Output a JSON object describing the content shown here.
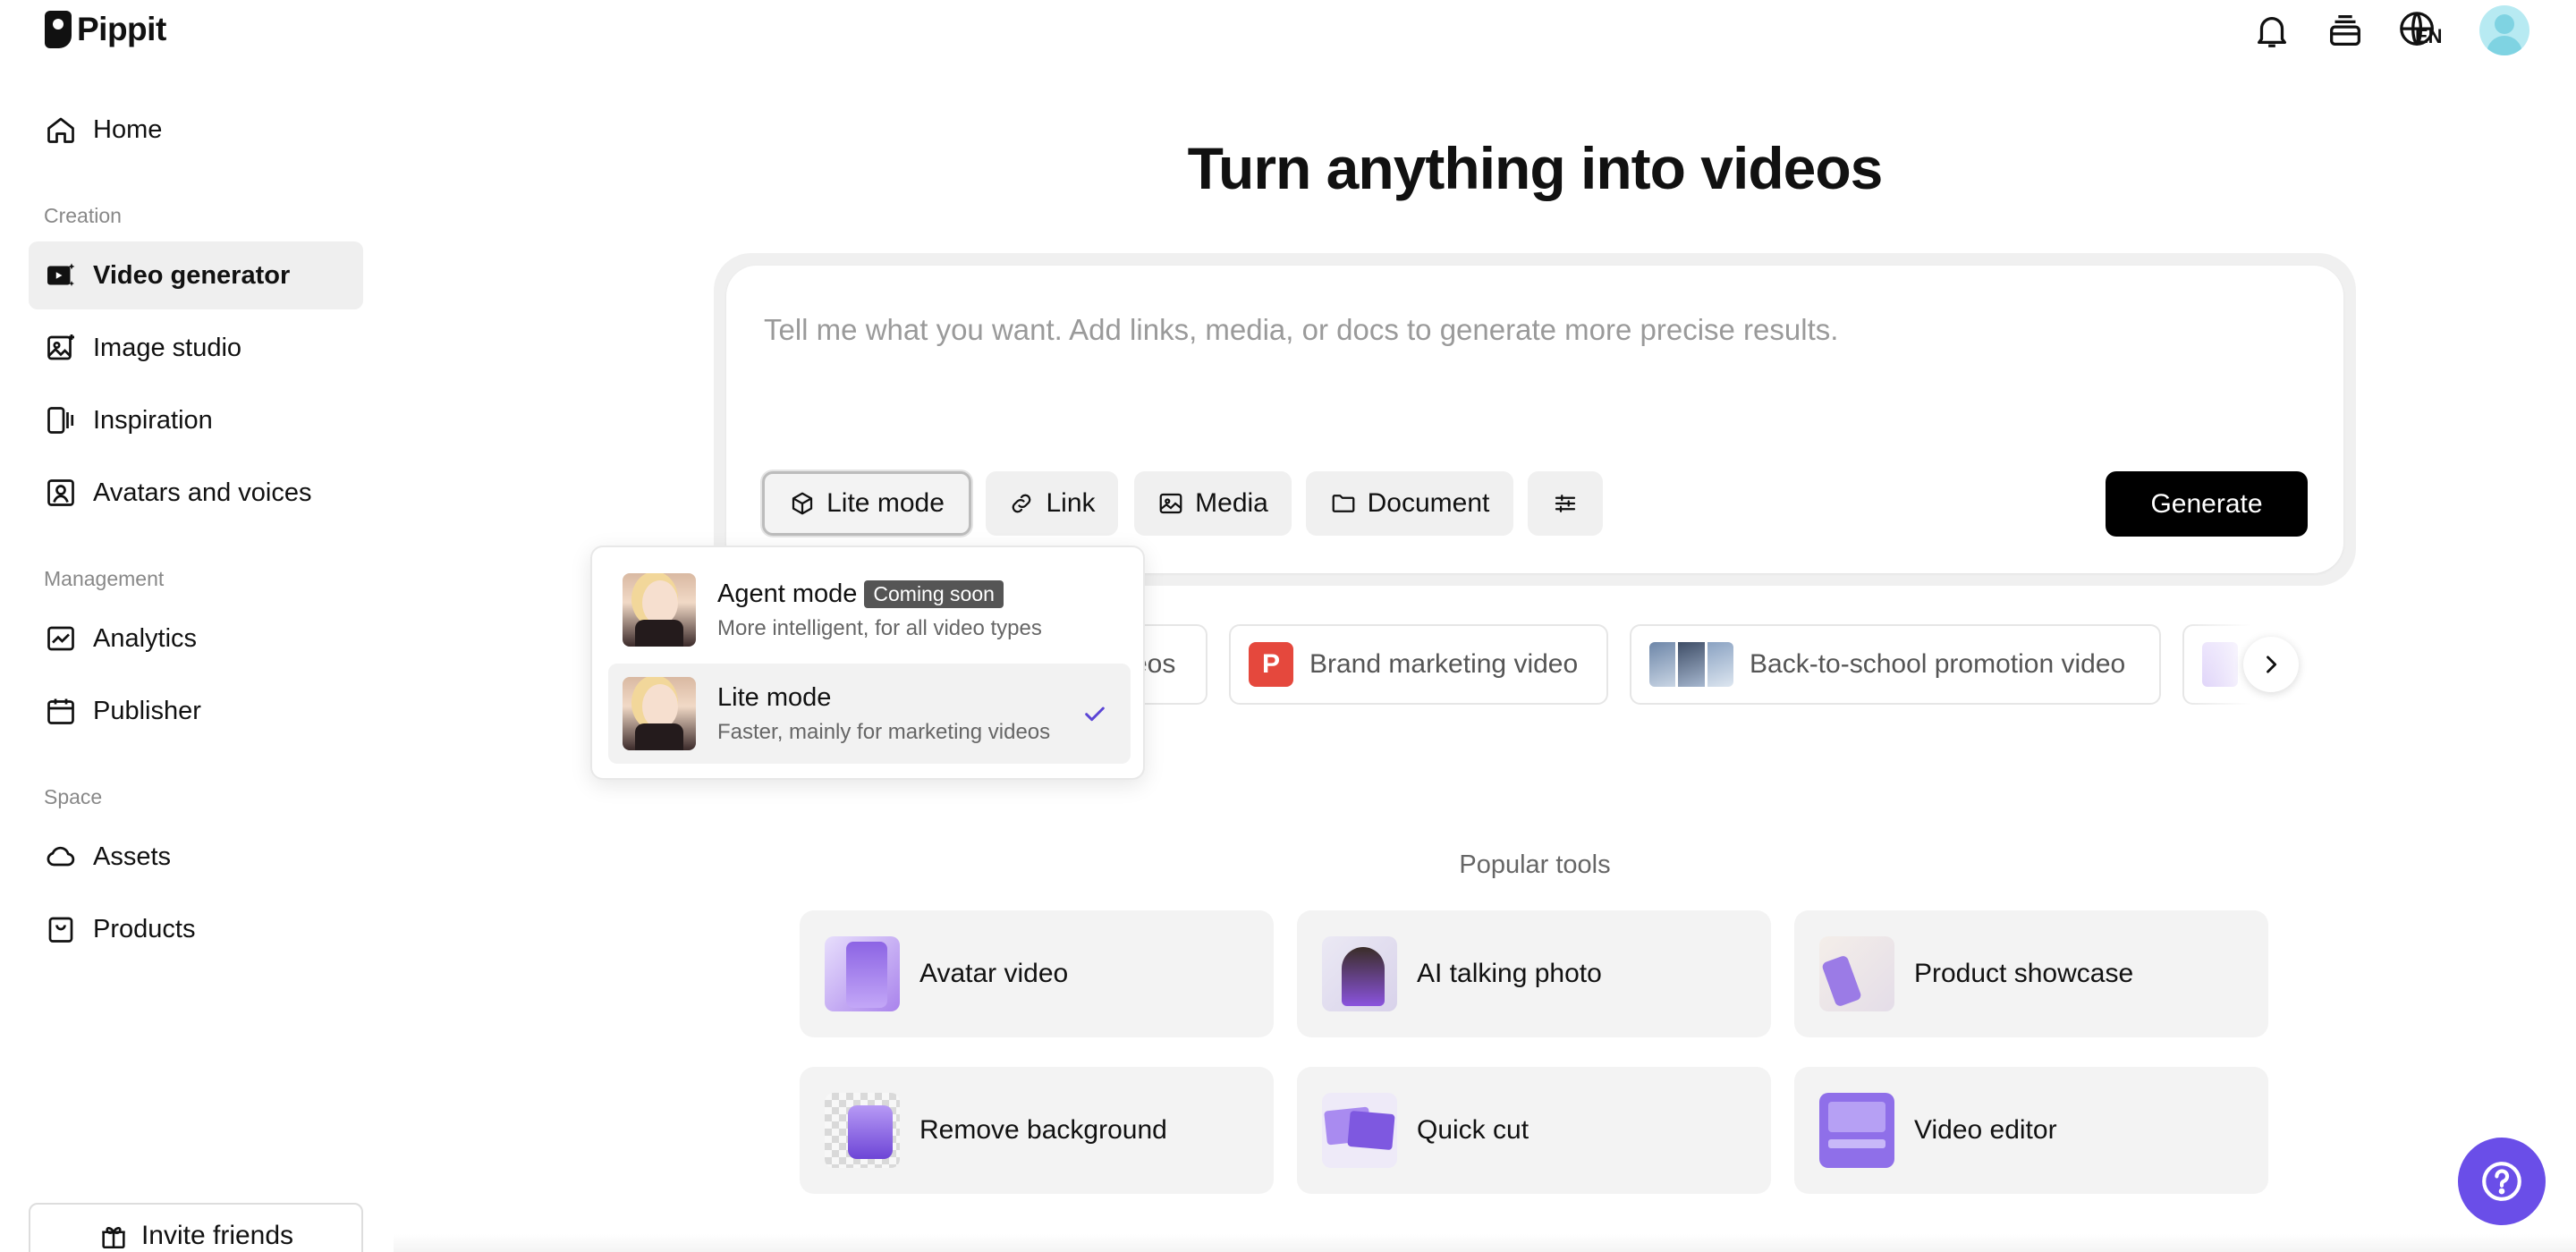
{
  "brand": {
    "name": "Pippit"
  },
  "sidebar": {
    "home": "Home",
    "sections": [
      {
        "label": "Creation",
        "items": [
          "Video generator",
          "Image studio",
          "Inspiration",
          "Avatars and voices"
        ]
      },
      {
        "label": "Management",
        "items": [
          "Analytics",
          "Publisher"
        ]
      },
      {
        "label": "Space",
        "items": [
          "Assets",
          "Products"
        ]
      }
    ],
    "active_item": "Video generator",
    "invite": "Invite friends"
  },
  "topbar": {
    "icons": [
      "bell-icon",
      "stack-icon",
      "globe-icon",
      "user-avatar"
    ],
    "language": "EN"
  },
  "main": {
    "title": "Turn anything into videos",
    "prompt_placeholder": "Tell me what you want. Add links, media, or docs to generate more precise results.",
    "chips": [
      "Lite mode",
      "Link",
      "Media",
      "Document"
    ],
    "generate": "Generate",
    "suggestions": [
      "eos",
      "Brand marketing video",
      "Back-to-school promotion video"
    ],
    "brand_badge_letter": "P",
    "popular_label": "Popular tools",
    "tools": [
      "Avatar video",
      "AI talking photo",
      "Product showcase",
      "Remove background",
      "Quick cut",
      "Video editor"
    ]
  },
  "mode_menu": {
    "options": [
      {
        "title": "Agent mode",
        "badge": "Coming soon",
        "desc": "More intelligent, for all video types",
        "selected": false
      },
      {
        "title": "Lite mode",
        "badge": "",
        "desc": "Faster, mainly for marketing videos",
        "selected": true
      }
    ]
  },
  "colors": {
    "accent": "#6a4ee8",
    "check": "#5b45d6",
    "generate_bg": "#000000",
    "brand_badge": "#e5483d"
  }
}
